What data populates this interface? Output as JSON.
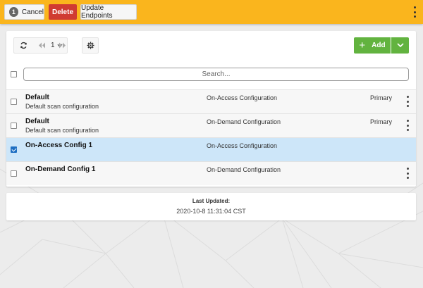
{
  "toolbar": {
    "badge_count": "1",
    "cancel_label": "Cancel",
    "delete_label": "Delete",
    "update_label": "Update Endpoints"
  },
  "grid": {
    "page": "1",
    "add_label": "Add",
    "search_placeholder": "Search...",
    "rows": [
      {
        "name": "Default",
        "description": "Default scan configuration",
        "type": "On-Access Configuration",
        "priority": "Primary",
        "checked": false,
        "selected": false,
        "menu": true
      },
      {
        "name": "Default",
        "description": "Default scan configuration",
        "type": "On-Demand Configuration",
        "priority": "Primary",
        "checked": false,
        "selected": false,
        "menu": true
      },
      {
        "name": "On-Access Config 1",
        "description": "",
        "type": "On-Access Configuration",
        "priority": "",
        "checked": true,
        "selected": true,
        "menu": false
      },
      {
        "name": "On-Demand Config 1",
        "description": "",
        "type": "On-Demand Configuration",
        "priority": "",
        "checked": false,
        "selected": false,
        "menu": true
      }
    ]
  },
  "footer": {
    "label": "Last Updated:",
    "value": "2020-10-8 11:31:04 CST"
  },
  "colors": {
    "topbar": "#fab51d",
    "delete": "#d03b32",
    "add": "#62b33f",
    "selected_row": "#cde6f9",
    "checkbox": "#1f6fc2"
  }
}
